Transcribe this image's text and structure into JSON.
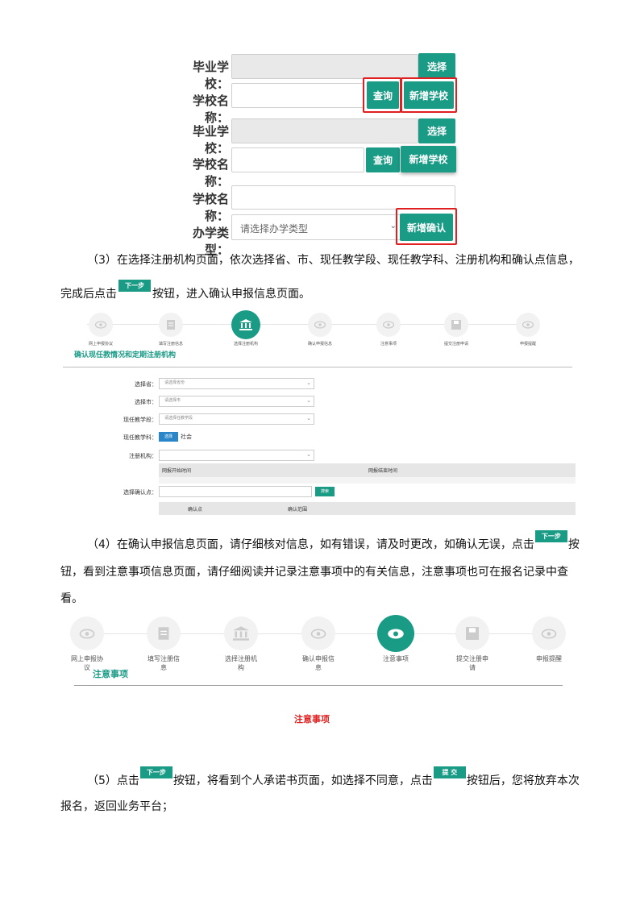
{
  "form1": {
    "grad_school_label": "毕业学校：",
    "school_name_label": "学校名称：",
    "select_btn": "选择",
    "query_btn": "查询",
    "add_school_btn": "新增学校",
    "school_type_label": "办学类型：",
    "school_type_placeholder": "请选择办学类型",
    "add_confirm_btn": "新增确认"
  },
  "para3": {
    "line1": "（3）在选择注册机构页面，依次选择省、市、现任教学段、现任教学科、注册机构和确认点信息，",
    "line2a": "完成后点击",
    "line2b": "按钮，进入确认申报信息页面。"
  },
  "next_btn": "下一步",
  "submit_btn": "提 交",
  "steps_small": [
    "网上申报协议",
    "填写注册信息",
    "选择注册机构",
    "确认申报信息",
    "注意事项",
    "提交注册申请",
    "申报提醒"
  ],
  "form2": {
    "section_title": "确认现任教情况和定期注册机构",
    "province_label": "选择省：",
    "province_ph": "请选择省份",
    "city_label": "选择市：",
    "city_ph": "请选择市",
    "stage_label": "现任教学段：",
    "stage_ph": "请选择任教学段",
    "subject_label": "现任教学科：",
    "subject_btn": "选择",
    "subject_value": "社会",
    "org_label": "注册机构：",
    "col_start": "网报开始时间",
    "col_end": "网报结束时间",
    "confirm_point_label": "选择确认点：",
    "search_btn": "搜索",
    "col_point": "确认点",
    "col_range": "确认范围"
  },
  "para4": {
    "line1a": "（4）在确认申报信息页面，请仔细核对信息，如有错误，请及时更改，如确认无误，点击",
    "line1b": "按",
    "line2": "钮，看到注意事项信息页面，请仔细阅读并记录注意事项中的有关信息，注意事项也可在报名记录中查",
    "line3": "看。"
  },
  "steps_large": [
    [
      "网上申报协",
      "议"
    ],
    [
      "填写注册信",
      "息"
    ],
    [
      "选择注册机",
      "构"
    ],
    [
      "确认申报信",
      "息"
    ],
    [
      "注意事项"
    ],
    [
      "提交注册申",
      "请"
    ],
    [
      "申报提醒"
    ]
  ],
  "notice_heading": "注意事项",
  "notice_title_red": "注意事项",
  "para5": {
    "p1": "（5）点击",
    "p2": "按钮，将看到个人承诺书页面，如选择不同意，点击",
    "p3": "按钮后，您将放弃本次",
    "line2": "报名，返回业务平台；"
  },
  "colors": {
    "accent": "#1a9b86",
    "highlight": "#e02020",
    "notice_red": "#e02020"
  }
}
